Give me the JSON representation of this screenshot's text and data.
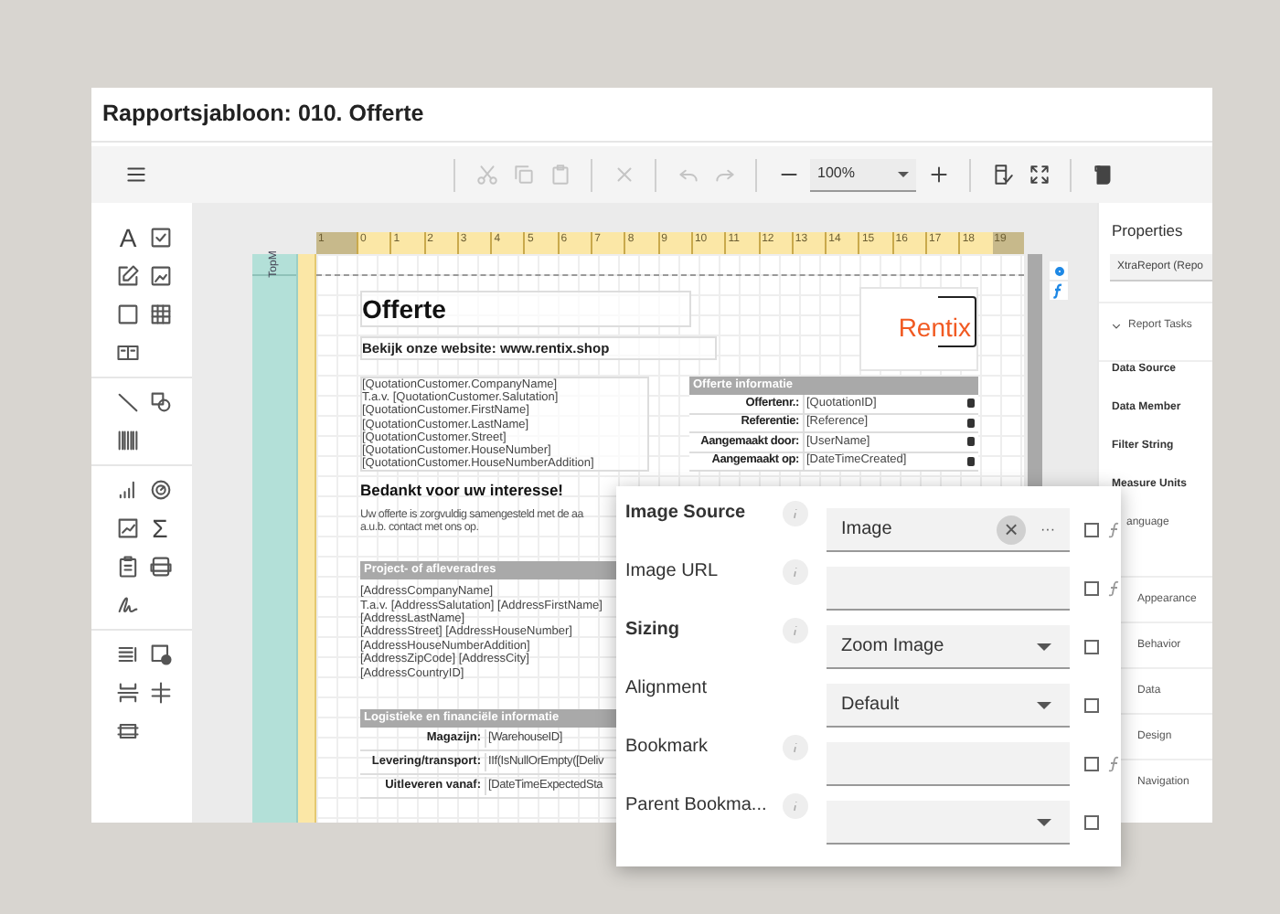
{
  "window": {
    "title": "Rapportsjabloon: 010. Offerte"
  },
  "toolbar": [
    {
      "kind": "menu",
      "disabled": false
    },
    {
      "kind": "sep"
    },
    {
      "kind": "cut",
      "disabled": true
    },
    {
      "kind": "copy",
      "disabled": true
    },
    {
      "kind": "paste",
      "disabled": true
    },
    {
      "kind": "sep"
    },
    {
      "kind": "delete",
      "disabled": true
    },
    {
      "kind": "sep"
    },
    {
      "kind": "undo",
      "disabled": true
    },
    {
      "kind": "redo",
      "disabled": true
    },
    {
      "kind": "sep"
    },
    {
      "kind": "minus",
      "disabled": false
    },
    {
      "kind": "zoom",
      "value": "100%"
    },
    {
      "kind": "plus",
      "disabled": false
    },
    {
      "kind": "sep"
    },
    {
      "kind": "validate",
      "disabled": false
    },
    {
      "kind": "fullscreen",
      "disabled": false
    },
    {
      "kind": "sep"
    },
    {
      "kind": "script",
      "disabled": false
    }
  ],
  "toolbox": [
    [
      {
        "kind": "glyph",
        "text": "A"
      },
      {
        "kind": "checkbox"
      },
      {
        "kind": "edit"
      },
      {
        "kind": "picture"
      },
      {
        "kind": "square"
      },
      {
        "kind": "table"
      },
      {
        "kind": "dual"
      }
    ],
    [
      {
        "kind": "line"
      },
      {
        "kind": "shapes"
      },
      {
        "kind": "barcode"
      }
    ],
    [
      {
        "kind": "bars"
      },
      {
        "kind": "gauge"
      },
      {
        "kind": "linechart"
      },
      {
        "kind": "glyph",
        "text": "Σ"
      },
      {
        "kind": "clipboard"
      },
      {
        "kind": "pdf"
      },
      {
        "kind": "signature"
      }
    ],
    [
      {
        "kind": "list"
      },
      {
        "kind": "pageinfo"
      },
      {
        "kind": "pagebreak"
      },
      {
        "kind": "cross"
      },
      {
        "kind": "band"
      }
    ]
  ],
  "designer": {
    "band_label": "TopM",
    "ruler_labels": [
      "1",
      "0",
      "1",
      "2",
      "3",
      "4",
      "5",
      "6",
      "7",
      "8",
      "9",
      "10",
      "11",
      "12",
      "13",
      "14",
      "15",
      "16",
      "17",
      "18",
      "19"
    ],
    "title": "Offerte",
    "website": "Bekijk onze website: www.rentix.shop",
    "logo": "Rentix",
    "customer_lines": [
      "[QuotationCustomer.CompanyName]",
      "T.a.v. [QuotationCustomer.Salutation]",
      "[QuotationCustomer.FirstName]",
      "[QuotationCustomer.LastName]",
      "[QuotationCustomer.Street]",
      "[QuotationCustomer.HouseNumber]",
      "[QuotationCustomer.HouseNumberAddition]"
    ],
    "info_header": "Offerte informatie",
    "info_rows": [
      {
        "label": "Offertenr.:",
        "value": "[QuotationID]"
      },
      {
        "label": "Referentie:",
        "value": "[Reference]"
      },
      {
        "label": "Aangemaakt door:",
        "value": "[UserName]"
      },
      {
        "label": "Aangemaakt op:",
        "value": "[DateTimeCreated]"
      }
    ],
    "thanks": "Bedankt voor uw interesse!",
    "message_lines": [
      "Uw offerte is zorgvuldig samengesteld met de aa",
      "a.u.b. contact met ons op."
    ],
    "address_header": "Project- of afleveradres",
    "address_lines": [
      "[AddressCompanyName]",
      "T.a.v. [AddressSalutation] [AddressFirstName]",
      "[AddressLastName]",
      "[AddressStreet] [AddressHouseNumber]",
      "[AddressHouseNumberAddition]",
      "[AddressZipCode] [AddressCity]",
      "[AddressCountryID]"
    ],
    "logistics_header": "Logistieke en financiële informatie",
    "logistics_rows": [
      {
        "label": "Magazijn:",
        "value": "[WarehouseID]"
      },
      {
        "label": "Levering/transport:",
        "value": "IIf(IsNullOrEmpty([Deliv"
      },
      {
        "label": "Uitleveren vanaf:",
        "value": "[DateTimeExpectedSta"
      }
    ]
  },
  "properties": {
    "title": "Properties",
    "object": "XtraReport (Repo",
    "tasks": "Report Tasks",
    "task_items": [
      "Data Source",
      "Data Member",
      "Filter String",
      "Measure Units"
    ],
    "partial_item": "anguage",
    "categories": [
      "Appearance",
      "Behavior",
      "Data",
      "Design",
      "Navigation"
    ]
  },
  "popup": {
    "rows": [
      {
        "label": "Image Source",
        "bold": true,
        "info": true,
        "kind": "image",
        "value": "Image",
        "clear": "×",
        "more": "···",
        "checked": false,
        "expression": true
      },
      {
        "label": "Image URL",
        "bold": false,
        "info": true,
        "kind": "text",
        "checked": false,
        "expression": true
      },
      {
        "label": "Sizing",
        "bold": true,
        "info": true,
        "kind": "select",
        "value": "Zoom Image",
        "checked": false,
        "expression": false
      },
      {
        "label": "Alignment",
        "bold": false,
        "info": false,
        "kind": "select",
        "value": "Default",
        "checked": false,
        "expression": false
      },
      {
        "label": "Bookmark",
        "bold": false,
        "info": true,
        "kind": "text",
        "checked": false,
        "expression": true
      },
      {
        "label": "Parent Bookma...",
        "bold": false,
        "info": true,
        "kind": "select",
        "checked": false,
        "expression": false
      }
    ]
  }
}
